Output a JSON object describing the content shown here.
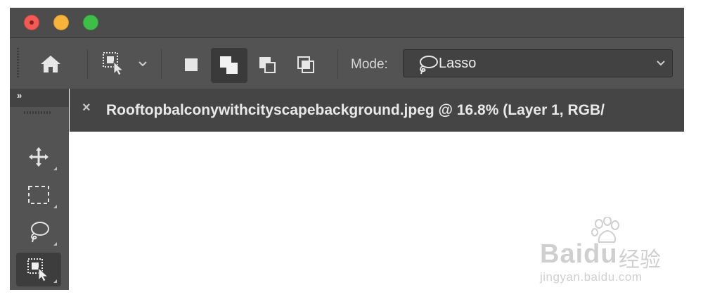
{
  "window": {
    "controls": {
      "close_color": "#f25a55",
      "minimize_color": "#f6b43a",
      "maximize_color": "#3fbf4a"
    }
  },
  "options_bar": {
    "home_icon": "home-icon",
    "tool_preset_icon": "object-selection-icon",
    "selection_modes": [
      {
        "name": "new-selection",
        "icon": "new-selection-icon",
        "active": false
      },
      {
        "name": "add-to-selection",
        "icon": "add-to-selection-icon",
        "active": true
      },
      {
        "name": "subtract-from-selection",
        "icon": "subtract-from-selection-icon",
        "active": false
      },
      {
        "name": "intersect-with-selection",
        "icon": "intersect-selection-icon",
        "active": false
      }
    ],
    "mode_label": "Mode:",
    "mode_value": "Lasso",
    "mode_icon": "lasso-icon"
  },
  "tools_panel": {
    "collapse_label": "»",
    "tools": [
      {
        "name": "move",
        "icon": "move-icon",
        "active": false
      },
      {
        "name": "rectangular-marquee",
        "icon": "marquee-icon",
        "active": false
      },
      {
        "name": "lasso",
        "icon": "lasso-icon",
        "active": false
      },
      {
        "name": "object-selection",
        "icon": "object-selection-icon",
        "active": true
      }
    ]
  },
  "document": {
    "tab_close": "×",
    "tab_title": "Rooftopbalconywithcityscapebackground.jpeg @ 16.8% (Layer 1, RGB/"
  },
  "watermark": {
    "brand": "Baidu",
    "cn": "经验",
    "url": "jingyan.baidu.com"
  },
  "colors": {
    "titlebar": "#4c4c4c",
    "toolbar": "#535353",
    "panel_header": "#434343",
    "tab": "#454545",
    "active_bg": "#3a3a3a"
  }
}
